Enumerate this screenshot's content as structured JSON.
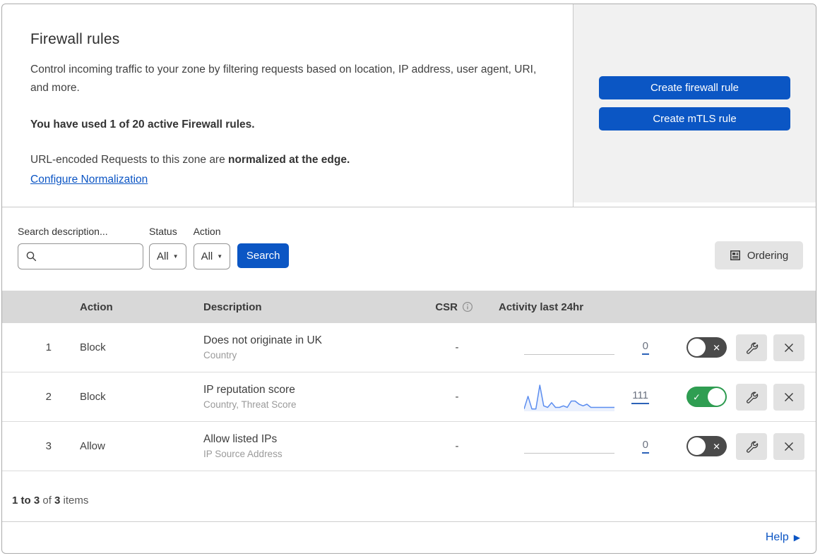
{
  "intro": {
    "title": "Firewall rules",
    "description": "Control incoming traffic to your zone by filtering requests based on location, IP address, user agent, URI, and more.",
    "usage_bold": "You have used 1 of 20 active Firewall rules.",
    "normalization_prefix": "URL-encoded Requests to this zone are ",
    "normalization_bold": "normalized at the edge.",
    "normalization_link": "Configure Normalization"
  },
  "actions": {
    "create_firewall_rule": "Create firewall rule",
    "create_mtls_rule": "Create mTLS rule"
  },
  "filters": {
    "search_label": "Search description...",
    "status_label": "Status",
    "status_value": "All",
    "action_label": "Action",
    "action_value": "All",
    "search_button": "Search",
    "ordering_button": "Ordering"
  },
  "table": {
    "headers": {
      "action": "Action",
      "description": "Description",
      "csr": "CSR",
      "activity": "Activity last 24hr"
    },
    "rows": [
      {
        "num": "1",
        "action": "Block",
        "description": "Does not originate in UK",
        "fields": "Country",
        "csr": "-",
        "activity_count": "0",
        "enabled": false,
        "has_sparkline": false
      },
      {
        "num": "2",
        "action": "Block",
        "description": "IP reputation score",
        "fields": "Country, Threat Score",
        "csr": "-",
        "activity_count": "111",
        "enabled": true,
        "has_sparkline": true
      },
      {
        "num": "3",
        "action": "Allow",
        "description": "Allow listed IPs",
        "fields": "IP Source Address",
        "csr": "-",
        "activity_count": "0",
        "enabled": false,
        "has_sparkline": false
      }
    ]
  },
  "chart_data": {
    "type": "area",
    "title": "Activity last 24hr sparkline (rule 2)",
    "x_range_hours": 24,
    "values": [
      1,
      9,
      1,
      1,
      16,
      3,
      2,
      5,
      2,
      2,
      3,
      2,
      6,
      6,
      4,
      3,
      4,
      2,
      2,
      2,
      2,
      2,
      2,
      2
    ],
    "total_shown": "111",
    "line_color": "#5b8def",
    "fill_color": "rgba(91,141,239,0.12)"
  },
  "footer": {
    "range_bold": "1 to 3",
    "of_text": " of ",
    "total_bold": "3",
    "items_text": " items"
  },
  "help": {
    "label": "Help"
  },
  "colors": {
    "accent_blue": "#0b56c4",
    "link_blue": "#0b55c4",
    "toggle_on_green": "#2f9e52",
    "toggle_off_gray": "#4a4a4a",
    "panel_gray": "#f1f1f1",
    "table_header_gray": "#d8d8d8"
  }
}
